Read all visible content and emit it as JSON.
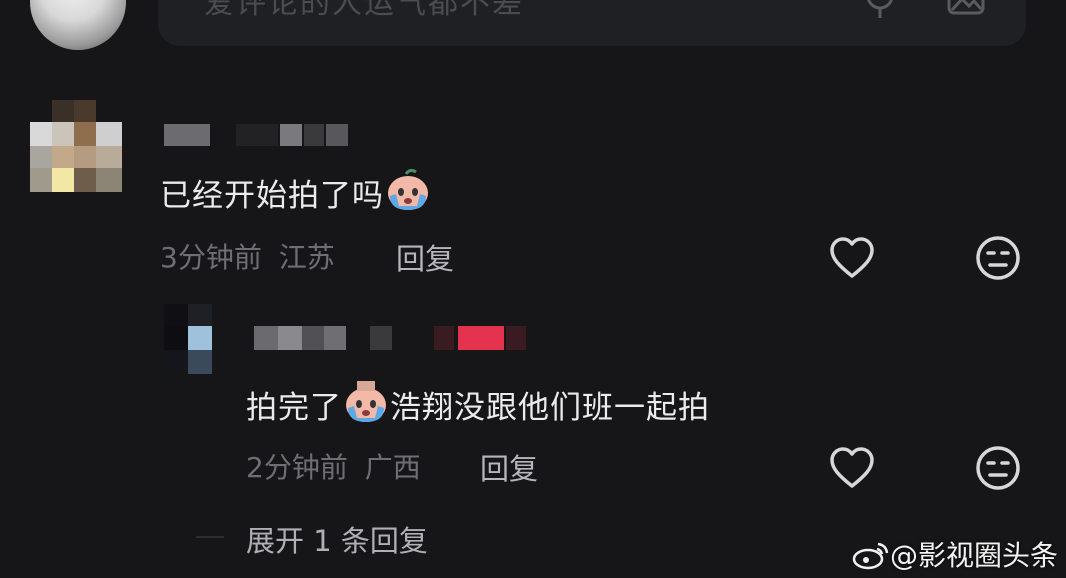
{
  "input": {
    "placeholder": "爱评论的人运气都不差"
  },
  "comments": [
    {
      "text_before_emoji": "已经开始拍了吗",
      "emoji": "crying-emoji",
      "time": "3分钟前",
      "location": "江苏",
      "reply_label": "回复"
    },
    {
      "text_before_emoji": "拍完了",
      "emoji": "crying-emoji",
      "text_after_emoji": "浩翔没跟他们班一起拍",
      "time": "2分钟前",
      "location": "广西",
      "reply_label": "回复"
    }
  ],
  "expand_label": "展开 1 条回复",
  "watermark": "@影视圈头条",
  "colors": {
    "background": "#161618",
    "text": "#ebebeb",
    "meta": "#6e6e73",
    "username_redaction_red": "#e5324f"
  }
}
